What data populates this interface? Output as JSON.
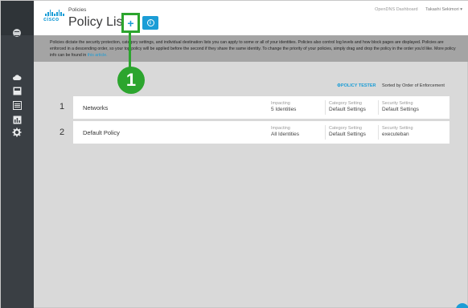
{
  "header": {
    "breadcrumb": "Policies",
    "title": "Policy List",
    "add_button_glyph": "+",
    "info_button_glyph": "i",
    "dashboard_link": "OpenDNS Dashboard",
    "user_name": "Takashi Sekimori ▾",
    "logo_word": "cisco"
  },
  "description": {
    "text": "Policies dictate the security protection, category settings, and individual destination lists you can apply to some or all of your identities.  Policies also control log levels and how block pages are displayed. Policies are enforced in a descending order, so your top policy will be applied before the second if they share the same identity. To change the priority of your policies, simply drag and drop the policy in the order you'd like.  More policy info can be found in ",
    "link_text": "this article."
  },
  "callout": {
    "step_number": "1",
    "color": "#2ca52e"
  },
  "toolbar": {
    "policy_tester": "⚙POLICY TESTER",
    "sort_label": "Sorted by Order of Enforcement"
  },
  "policies": [
    {
      "order": "1",
      "name": "Networks",
      "impacting_label": "Impacting",
      "impacting_value": "5 Identities",
      "category_label": "Category Setting",
      "category_value": "Default Settings",
      "security_label": "Security Setting",
      "security_value": "Default Settings"
    },
    {
      "order": "2",
      "name": "Default Policy",
      "impacting_label": "Impacting",
      "impacting_value": "All Identities",
      "category_label": "Category Setting",
      "category_value": "Default Settings",
      "security_label": "Security Setting",
      "security_value": "executeban"
    }
  ],
  "sidebar": {
    "icons": [
      "menu-icon",
      "cloud-icon",
      "report-icon",
      "list-icon",
      "chart-icon",
      "gear-icon"
    ]
  },
  "colors": {
    "accent": "#1b9dd6",
    "sidebar": "#3a3f44",
    "highlight": "#2ca52e"
  }
}
